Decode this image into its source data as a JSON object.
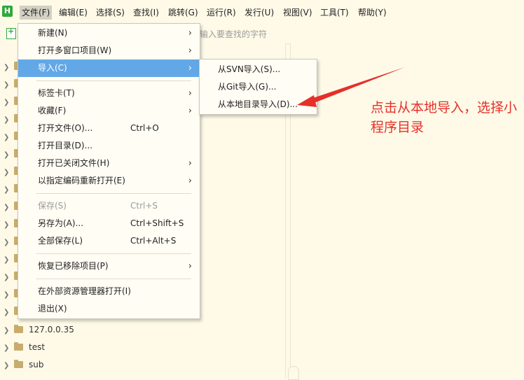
{
  "menubar": {
    "items": [
      "文件(F)",
      "编辑(E)",
      "选择(S)",
      "查找(I)",
      "跳转(G)",
      "运行(R)",
      "发行(U)",
      "视图(V)",
      "工具(T)",
      "帮助(Y)"
    ],
    "logo_text": "H"
  },
  "toolbar": {
    "search_placeholder": "输入要查找的字符"
  },
  "file_menu": {
    "items": [
      {
        "label": "新建(N)",
        "shortcut": "",
        "arrow": "›"
      },
      {
        "label": "打开多窗口项目(W)",
        "shortcut": "",
        "arrow": "›"
      },
      {
        "label": "导入(C)",
        "shortcut": "",
        "arrow": "›"
      },
      {
        "label": "标签卡(T)",
        "shortcut": "",
        "arrow": "›"
      },
      {
        "label": "收藏(F)",
        "shortcut": "",
        "arrow": "›"
      },
      {
        "label": "打开文件(O)...",
        "shortcut": "Ctrl+O",
        "arrow": ""
      },
      {
        "label": "打开目录(D)...",
        "shortcut": "",
        "arrow": ""
      },
      {
        "label": "打开已关闭文件(H)",
        "shortcut": "",
        "arrow": "›"
      },
      {
        "label": "以指定编码重新打开(E)",
        "shortcut": "",
        "arrow": "›"
      },
      {
        "label": "保存(S)",
        "shortcut": "Ctrl+S",
        "arrow": ""
      },
      {
        "label": "另存为(A)...",
        "shortcut": "Ctrl+Shift+S",
        "arrow": ""
      },
      {
        "label": "全部保存(L)",
        "shortcut": "Ctrl+Alt+S",
        "arrow": ""
      },
      {
        "label": "恢复已移除项目(P)",
        "shortcut": "",
        "arrow": "›"
      },
      {
        "label": "在外部资源管理器打开(I)",
        "shortcut": "",
        "arrow": ""
      },
      {
        "label": "退出(X)",
        "shortcut": "",
        "arrow": ""
      }
    ]
  },
  "import_submenu": {
    "items": [
      "从SVN导入(S)...",
      "从Git导入(G)...",
      "从本地目录导入(D)..."
    ]
  },
  "sidebar": {
    "folders": [
      "127.0.0.35",
      "test",
      "sub"
    ]
  },
  "annotation": {
    "text": "点击从本地导入，选择小程序目录",
    "color": "#e5302a"
  },
  "colors": {
    "background": "#fffae8",
    "menu_highlight": "#63a8e6",
    "logo": "#2eaa3c",
    "folder": "#c9ac6c"
  }
}
